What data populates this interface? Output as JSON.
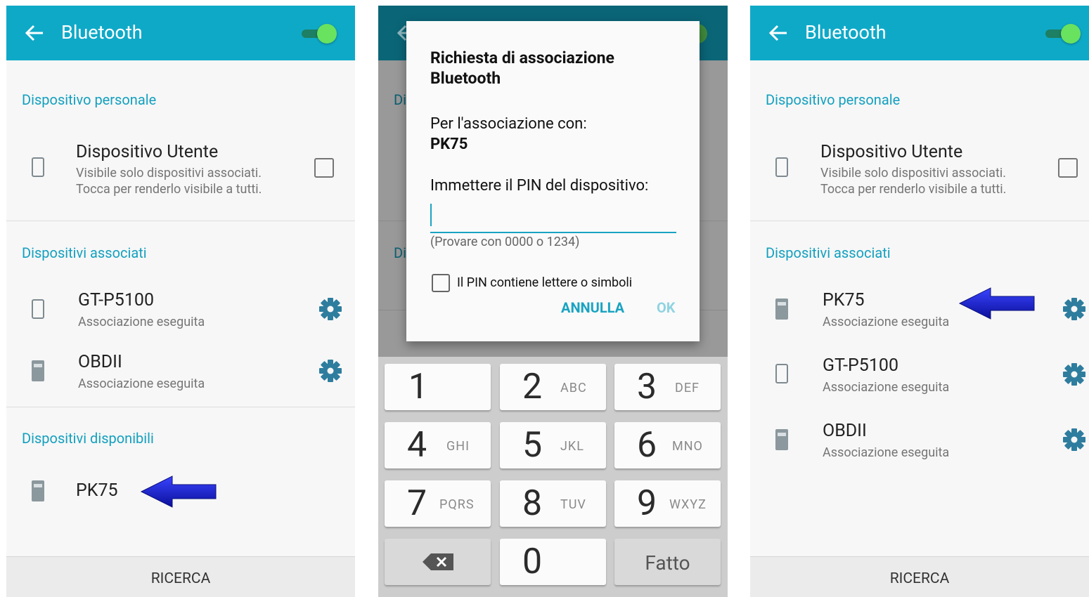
{
  "colors": {
    "accent": "#0fa9c8",
    "section": "#14a0bf",
    "arrow": "#1a22c9"
  },
  "panels": [
    {
      "title": "Bluetooth",
      "section_personal": "Dispositivo personale",
      "personal_device": {
        "name": "Dispositivo Utente",
        "line1": "Visibile solo dispositivi associati.",
        "line2": "Tocca per renderlo visibile a tutti."
      },
      "section_paired": "Dispositivi associati",
      "paired": [
        {
          "name": "GT-P5100",
          "status": "Associazione eseguita",
          "icon": "phone-outline-icon"
        },
        {
          "name": "OBDII",
          "status": "Associazione eseguita",
          "icon": "device-filled-icon"
        }
      ],
      "section_available": "Dispositivi disponibili",
      "available": [
        {
          "name": "PK75",
          "icon": "device-filled-icon"
        }
      ],
      "scan_button": "RICERCA"
    },
    {
      "dialog": {
        "title": "Richiesta di associazione Bluetooth",
        "pair_with_label": "Per l'associazione con:",
        "device_name": "PK75",
        "pin_prompt": "Immettere il PIN del dispositivo:",
        "pin_value": "",
        "hint": "(Provare con 0000 o 1234)",
        "checkbox_label": "Il PIN contiene lettere o simboli",
        "cancel_button": "ANNULLA",
        "ok_button": "OK"
      },
      "background_hints": {
        "section_a": "Di",
        "section_b": "Di"
      },
      "keypad": {
        "keys": [
          {
            "num": "1",
            "letters": ""
          },
          {
            "num": "2",
            "letters": "ABC"
          },
          {
            "num": "3",
            "letters": "DEF"
          },
          {
            "num": "4",
            "letters": "GHI"
          },
          {
            "num": "5",
            "letters": "JKL"
          },
          {
            "num": "6",
            "letters": "MNO"
          },
          {
            "num": "7",
            "letters": "PQRS"
          },
          {
            "num": "8",
            "letters": "TUV"
          },
          {
            "num": "9",
            "letters": "WXYZ"
          }
        ],
        "zero": "0",
        "done": "Fatto",
        "backspace_icon": "backspace-icon"
      }
    },
    {
      "title": "Bluetooth",
      "section_personal": "Dispositivo personale",
      "personal_device": {
        "name": "Dispositivo Utente",
        "line1": "Visibile solo dispositivi associati.",
        "line2": "Tocca per renderlo visibile a tutti."
      },
      "section_paired": "Dispositivi associati",
      "paired": [
        {
          "name": "PK75",
          "status": "Associazione eseguita",
          "icon": "device-filled-icon"
        },
        {
          "name": "GT-P5100",
          "status": "Associazione eseguita",
          "icon": "phone-outline-icon"
        },
        {
          "name": "OBDII",
          "status": "Associazione eseguita",
          "icon": "device-filled-icon"
        }
      ],
      "scan_button": "RICERCA"
    }
  ]
}
